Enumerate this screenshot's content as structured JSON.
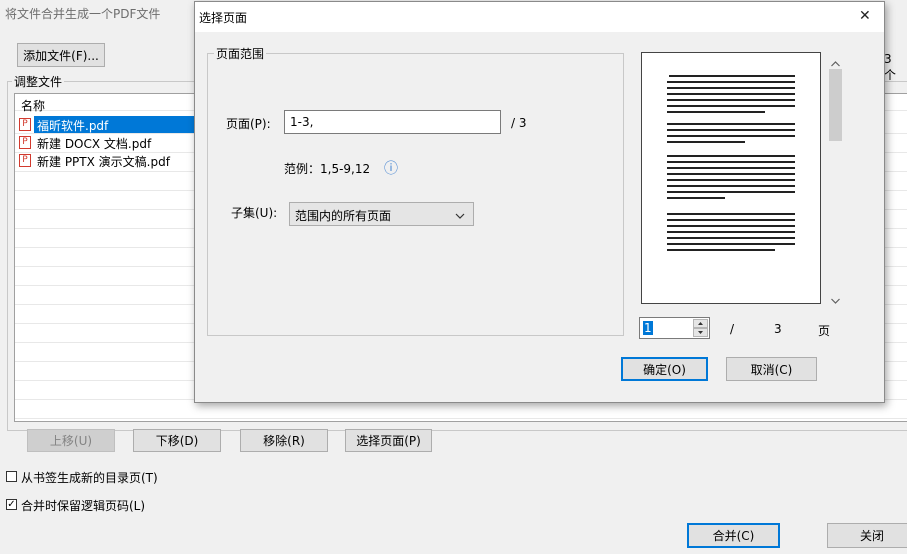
{
  "main_window": {
    "title": "将文件合并生成一个PDF文件",
    "add_files_button": "添加文件(F)...",
    "file_count_partial": "3 个",
    "adjust_group_label": "调整文件",
    "list_header_name": "名称",
    "files": [
      "福昕软件.pdf",
      "新建 DOCX 文档.pdf",
      "新建 PPTX 演示文稿.pdf"
    ],
    "buttons": {
      "move_up": "上移(U)",
      "move_down": "下移(D)",
      "remove": "移除(R)",
      "select_pages": "选择页面(P)"
    },
    "options": [
      {
        "label": "从书签生成新的目录页(T)",
        "checked": false
      },
      {
        "label": "合并时保留逻辑页码(L)",
        "checked": true
      }
    ],
    "merge_button": "合并(C)",
    "close_button": "关闭"
  },
  "dialog": {
    "title": "选择页面",
    "close_glyph": "✕",
    "group_label": "页面范围",
    "pages_label": "页面(P):",
    "pages_value": "1-3,",
    "pages_total": "/ 3",
    "example_text": "范例：1,5-9,12",
    "info_glyph": "ⓘ",
    "subset_label": "子集(U):",
    "subset_selected": "范围内的所有页面",
    "preview_page_value": "1",
    "preview_separator": "/",
    "preview_total": "3",
    "preview_unit": "页",
    "ok_button": "确定(O)",
    "cancel_button": "取消(C)"
  }
}
